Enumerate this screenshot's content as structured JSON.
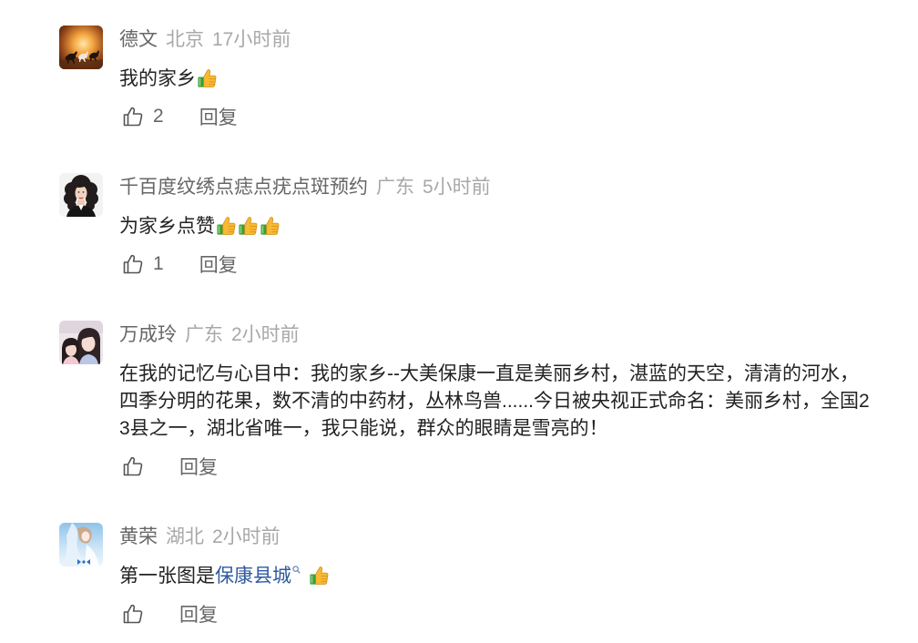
{
  "icons": {
    "like": "thumbs-up-outline-icon",
    "emoji": "thumbs-up-emoji",
    "link_icon": "search-icon"
  },
  "colors": {
    "name": "#666666",
    "meta": "#a8a8a8",
    "text": "#222222",
    "link": "#2f5a9e"
  },
  "comments": [
    {
      "name": "德文",
      "location": "北京",
      "time": "17小时前",
      "text": "我的家乡",
      "emojis": [
        "thumbs-up-emoji"
      ],
      "likes": "2",
      "reply_label": "回复"
    },
    {
      "name": "千百度纹绣点痣点疣点斑预约",
      "location": "广东",
      "time": "5小时前",
      "text": "为家乡点赞",
      "emojis": [
        "thumbs-up-emoji",
        "thumbs-up-emoji",
        "thumbs-up-emoji"
      ],
      "likes": "1",
      "reply_label": "回复"
    },
    {
      "name": "万成玲",
      "location": "广东",
      "time": "2小时前",
      "text": "在我的记忆与心目中：我的家乡--大美保康一直是美丽乡村，湛蓝的天空，清清的河水，四季分明的花果，数不清的中药材，丛林鸟兽......今日被央视正式命名：美丽乡村，全国23县之一，湖北省唯一，我只能说，群众的眼睛是雪亮的！",
      "likes": "",
      "reply_label": "回复"
    },
    {
      "name": "黄荣",
      "location": "湖北",
      "time": "2小时前",
      "text": "第一张图是",
      "link": "保康县城",
      "emojis": [
        "thumbs-up-emoji"
      ],
      "likes": "",
      "reply_label": "回复"
    }
  ]
}
